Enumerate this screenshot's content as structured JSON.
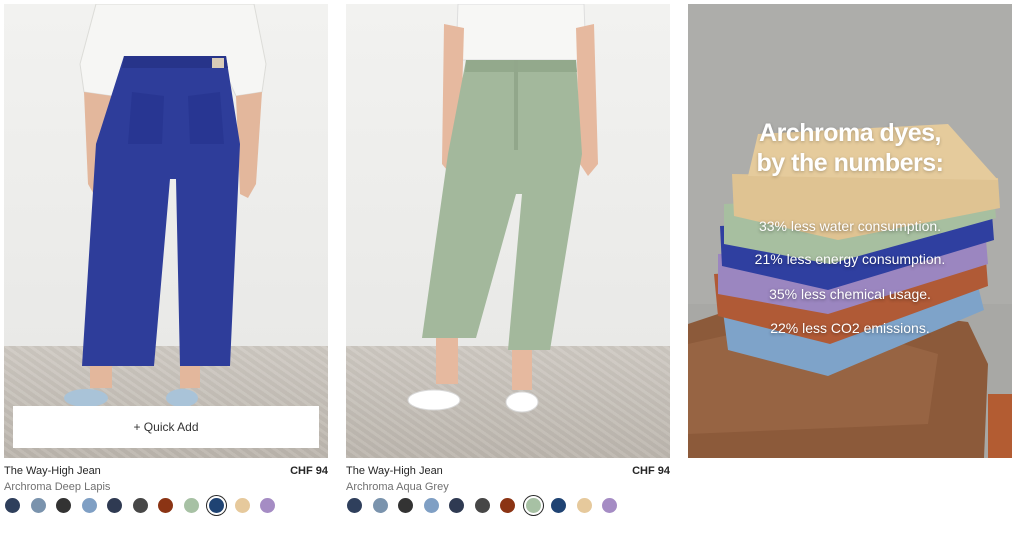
{
  "products": [
    {
      "name": "The Way-High Jean",
      "color_name": "Archroma Deep Lapis",
      "price": "CHF 94",
      "quick_add_label": "+ Quick Add",
      "selected_swatch": 8,
      "swatches": [
        "#2f3f5c",
        "#7a93ad",
        "#333333",
        "#7f9fc4",
        "#2f3a52",
        "#474747",
        "#8b3414",
        "#a7c1a4",
        "#1f4373",
        "#e6c99c",
        "#a58cc4"
      ]
    },
    {
      "name": "The Way-High Jean",
      "color_name": "Archroma Aqua Grey",
      "price": "CHF 94",
      "selected_swatch": 7,
      "swatches": [
        "#2f3f5c",
        "#7a93ad",
        "#333333",
        "#7f9fc4",
        "#2f3a52",
        "#474747",
        "#8b3414",
        "#a7c1a4",
        "#1f4373",
        "#e6c99c",
        "#a58cc4"
      ]
    }
  ],
  "promo": {
    "title_line1": "Archroma dyes,",
    "title_line2": "by the numbers:",
    "stats": [
      "33% less water consumption.",
      "21% less energy consumption.",
      "35% less chemical usage.",
      "22% less CO2 emissions."
    ]
  }
}
